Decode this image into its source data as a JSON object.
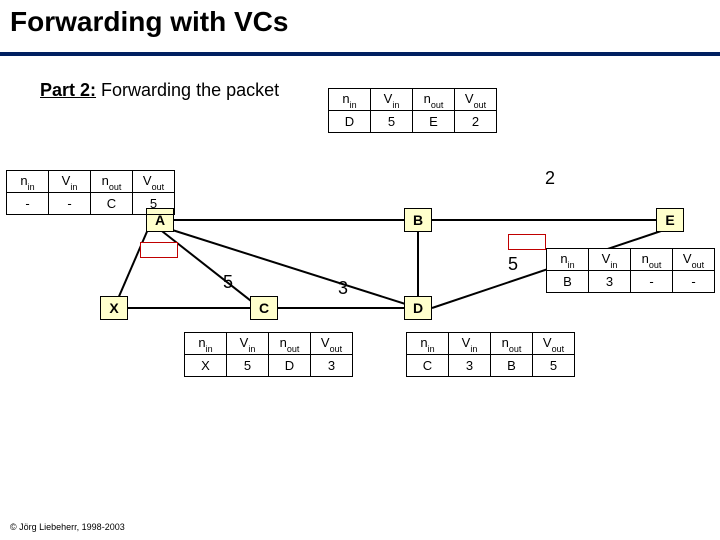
{
  "title": "Forwarding with VCs",
  "subtitle_bold": "Part 2:",
  "subtitle_rest": " Forwarding the packet",
  "footer": "© Jörg Liebeherr, 1998-2003",
  "hdr": {
    "nin": "n",
    "nin_s": "in",
    "vin": "V",
    "vin_s": "in",
    "nout": "n",
    "nout_s": "out",
    "vout": "V",
    "vout_s": "out"
  },
  "tabA": {
    "nin": "-",
    "vin": "-",
    "nout": "C",
    "vout": "5"
  },
  "tabB": {
    "nin": "D",
    "vin": "5",
    "nout": "E",
    "vout": "2"
  },
  "tabC": {
    "nin": "X",
    "vin": "5",
    "nout": "D",
    "vout": "3"
  },
  "tabD": {
    "nin": "C",
    "vin": "3",
    "nout": "B",
    "vout": "5"
  },
  "tabE": {
    "nin": "B",
    "vin": "3",
    "nout": "-",
    "vout": "-"
  },
  "nodes": {
    "A": "A",
    "B": "B",
    "C": "C",
    "D": "D",
    "E": "E",
    "X": "X"
  },
  "labels": {
    "AC": "5",
    "CD": "3",
    "DB": "5",
    "BE": "2"
  },
  "chart_data": {
    "type": "table",
    "title": "Forwarding with VCs — Part 2: Forwarding the packet",
    "topology": {
      "nodes": [
        "X",
        "A",
        "B",
        "C",
        "D",
        "E"
      ],
      "edges": [
        [
          "X",
          "A"
        ],
        [
          "A",
          "B"
        ],
        [
          "B",
          "E"
        ],
        [
          "X",
          "C"
        ],
        [
          "A",
          "C"
        ],
        [
          "A",
          "D"
        ],
        [
          "B",
          "D"
        ],
        [
          "C",
          "D"
        ],
        [
          "D",
          "E"
        ]
      ]
    },
    "edge_vci_labels": {
      "A-C": 5,
      "C-D": 3,
      "D-B": 5,
      "B-E": 2
    },
    "forwarding_tables": {
      "A": {
        "n_in": "-",
        "V_in": "-",
        "n_out": "C",
        "V_out": 5
      },
      "B": {
        "n_in": "D",
        "V_in": 5,
        "n_out": "E",
        "V_out": 2
      },
      "C": {
        "n_in": "X",
        "V_in": 5,
        "n_out": "D",
        "V_out": 3
      },
      "D": {
        "n_in": "C",
        "V_in": 3,
        "n_out": "B",
        "V_out": 5
      },
      "E": {
        "n_in": "B",
        "V_in": 3,
        "n_out": "-",
        "V_out": "-"
      }
    },
    "packet_path": [
      "A",
      "C",
      "D",
      "B",
      "E"
    ]
  }
}
